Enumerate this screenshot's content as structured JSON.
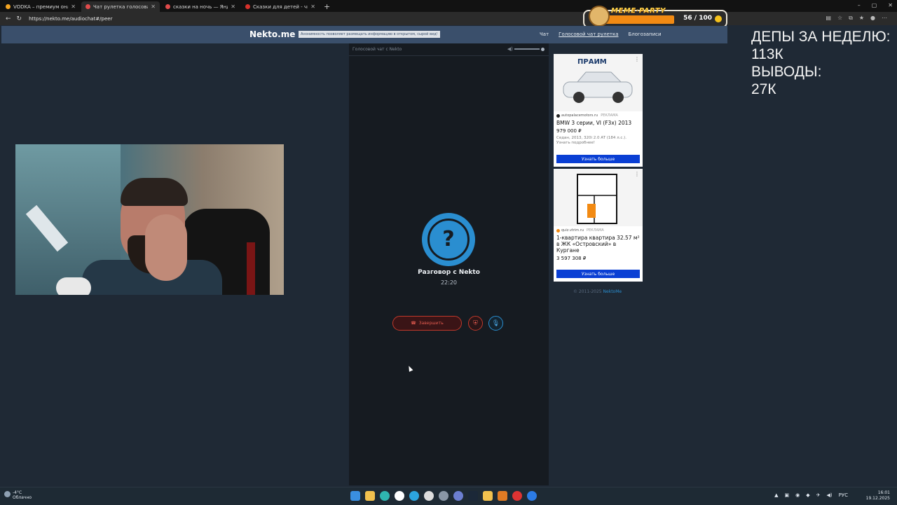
{
  "browser": {
    "tabs": [
      {
        "title": "VODKA – премиум онлайн-каз",
        "color": "#f5a623",
        "active": false
      },
      {
        "title": "Чат рулетка голосовая — N",
        "color": "#e04b4b",
        "active": true
      },
      {
        "title": "сказки на ночь — Яндекс: наш",
        "color": "#e04b4b",
        "active": false
      },
      {
        "title": "Сказки для детей - читать детс",
        "color": "#d6312b",
        "active": false
      }
    ],
    "new_tab": "+",
    "window_controls": [
      "–",
      "▢",
      "✕"
    ],
    "url": "https://nekto.me/audiochat#/peer"
  },
  "overlay": {
    "title": "MEME·PARTY",
    "score": "56 / 100"
  },
  "site": {
    "logo": "Nekto.me",
    "notice": "Анонимность позволяет размещать информацию в открытом, сырой вид!",
    "nav": [
      "Чат",
      "Голосовой чат рулетка",
      "Блогозаписи"
    ]
  },
  "stream_text": [
    "ДЕПЫ ЗА НЕДЕЛЮ:",
    "113К",
    "ВЫВОДЫ:",
    "27К"
  ],
  "chat": {
    "header": "Голосовой чат с Nekto",
    "avatar_glyph": "?",
    "name": "Разговор с Nekto",
    "timer": "22:20",
    "end_label": "Завершить"
  },
  "ads": [
    {
      "brand": "ПРАИМ",
      "source": "autopalacemotors.ru",
      "badge": "РЕКЛАМА",
      "title": "BMW 3 серии, VI (F3x) 2013",
      "price": "979 000 ₽",
      "desc": "Седан, 2013, 320i 2.0 AT (184 л.с.). Узнать подробнее!",
      "cta": "Узнать больше"
    },
    {
      "source": "quiz.vtrim.ru",
      "badge": "РЕКЛАМА",
      "title": "1-квартира квартира 32.57 м² в ЖК «Островский» в Кургане",
      "price": "3 597 308 ₽",
      "cta": "Узнать больше"
    }
  ],
  "footer": {
    "copy": "© 2011-2025",
    "link": "NektoMe"
  },
  "taskbar": {
    "temp": "-4°C",
    "weather": "Облачно",
    "lang": "РУС",
    "time": "16:01",
    "date": "19.12.2025"
  }
}
